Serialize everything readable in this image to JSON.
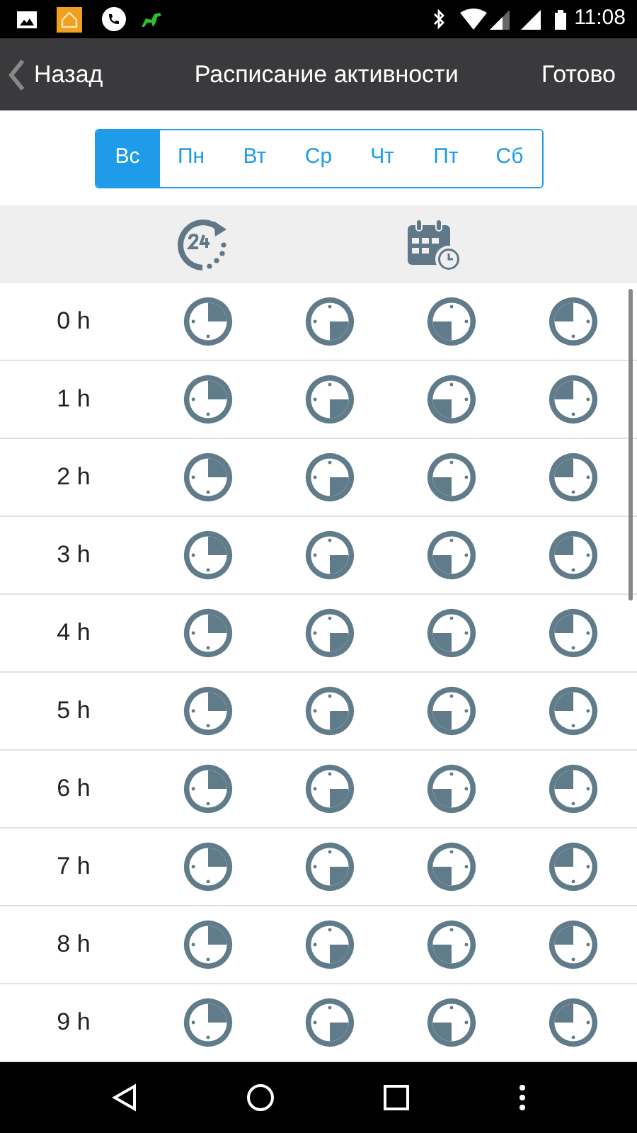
{
  "status_bar": {
    "time": "11:08"
  },
  "nav": {
    "back": "Назад",
    "title": "Расписание активности",
    "done": "Готово"
  },
  "days": [
    {
      "label": "Вс",
      "selected": true
    },
    {
      "label": "Пн",
      "selected": false
    },
    {
      "label": "Вт",
      "selected": false
    },
    {
      "label": "Ср",
      "selected": false
    },
    {
      "label": "Чт",
      "selected": false
    },
    {
      "label": "Пт",
      "selected": false
    },
    {
      "label": "Сб",
      "selected": false
    }
  ],
  "hours": [
    {
      "label": "0 h",
      "quarters": [
        true,
        true,
        true,
        true
      ]
    },
    {
      "label": "1 h",
      "quarters": [
        true,
        true,
        true,
        true
      ]
    },
    {
      "label": "2 h",
      "quarters": [
        true,
        true,
        true,
        true
      ]
    },
    {
      "label": "3 h",
      "quarters": [
        true,
        true,
        true,
        true
      ]
    },
    {
      "label": "4 h",
      "quarters": [
        true,
        true,
        true,
        true
      ]
    },
    {
      "label": "5 h",
      "quarters": [
        true,
        true,
        true,
        true
      ]
    },
    {
      "label": "6 h",
      "quarters": [
        true,
        true,
        true,
        true
      ]
    },
    {
      "label": "7 h",
      "quarters": [
        true,
        true,
        true,
        true
      ]
    },
    {
      "label": "8 h",
      "quarters": [
        true,
        true,
        true,
        true
      ]
    },
    {
      "label": "9 h",
      "quarters": [
        true,
        true,
        true,
        true
      ]
    }
  ]
}
